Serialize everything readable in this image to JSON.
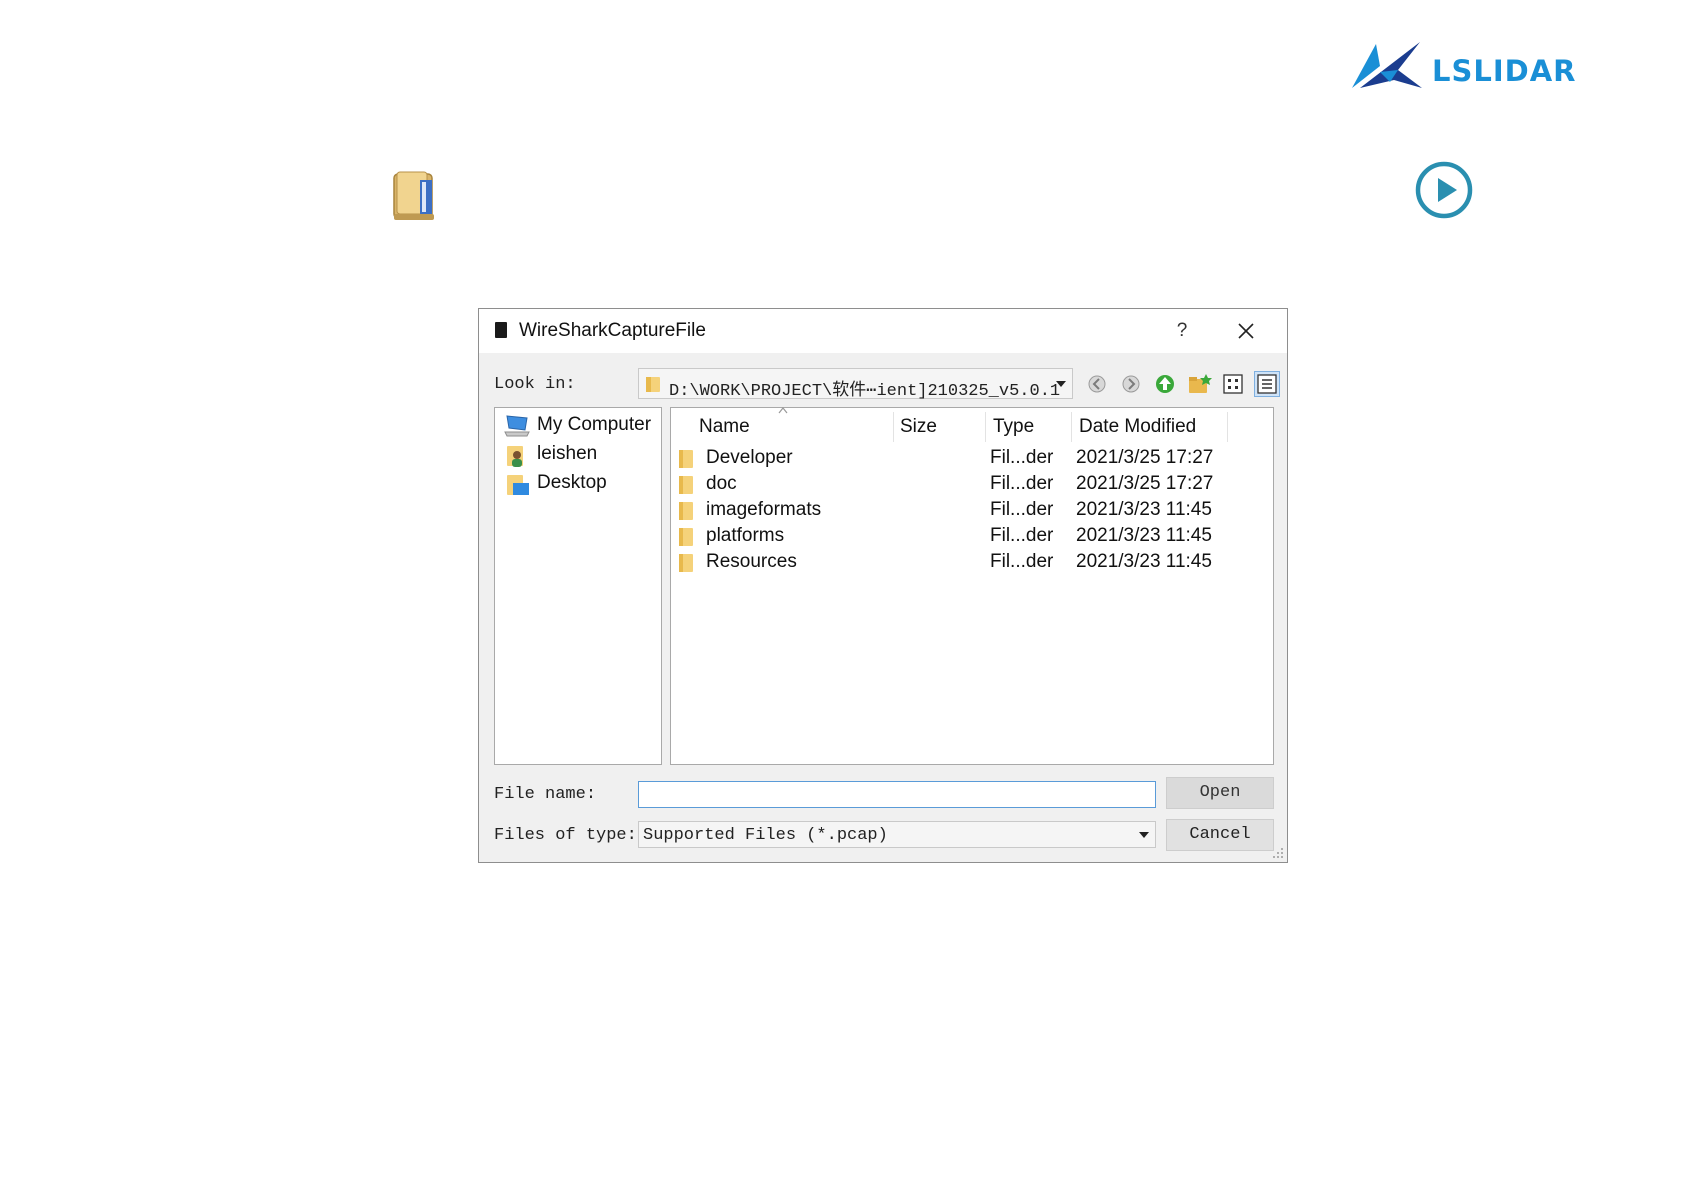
{
  "brand": {
    "logo_text": "LSLIDAR",
    "accent": "#1a8fd6",
    "dark": "#1b3d8f"
  },
  "play_icon_color": "#2a8fb0",
  "dialog": {
    "title": "WireSharkCaptureFile",
    "help_label": "?",
    "look_in_label": "Look in:",
    "look_in_path": "D:\\WORK\\PROJECT\\软件⋯ient]210325_v5.0.1",
    "toolbar": [
      "back-icon",
      "forward-icon",
      "parent-folder-icon",
      "new-folder-icon",
      "list-view-icon",
      "detail-view-icon"
    ],
    "sidebar": [
      {
        "label": "My Computer",
        "icon": "computer-icon"
      },
      {
        "label": "leishen",
        "icon": "user-folder-icon"
      },
      {
        "label": "Desktop",
        "icon": "desktop-icon"
      }
    ],
    "columns": [
      "Name",
      "Size",
      "Type",
      "Date Modified"
    ],
    "rows": [
      {
        "name": "Developer",
        "size": "",
        "type": "Fil...der",
        "date": "2021/3/25 17:27"
      },
      {
        "name": "doc",
        "size": "",
        "type": "Fil...der",
        "date": "2021/3/25 17:27"
      },
      {
        "name": "imageformats",
        "size": "",
        "type": "Fil...der",
        "date": "2021/3/23 11:45"
      },
      {
        "name": "platforms",
        "size": "",
        "type": "Fil...der",
        "date": "2021/3/23 11:45"
      },
      {
        "name": "Resources",
        "size": "",
        "type": "Fil...der",
        "date": "2021/3/23 11:45"
      }
    ],
    "file_name_label": "File name:",
    "file_name_value": "",
    "file_type_label": "Files of type:",
    "file_type_value": "Supported Files (*.pcap)",
    "open_label": "Open",
    "cancel_label": "Cancel"
  }
}
